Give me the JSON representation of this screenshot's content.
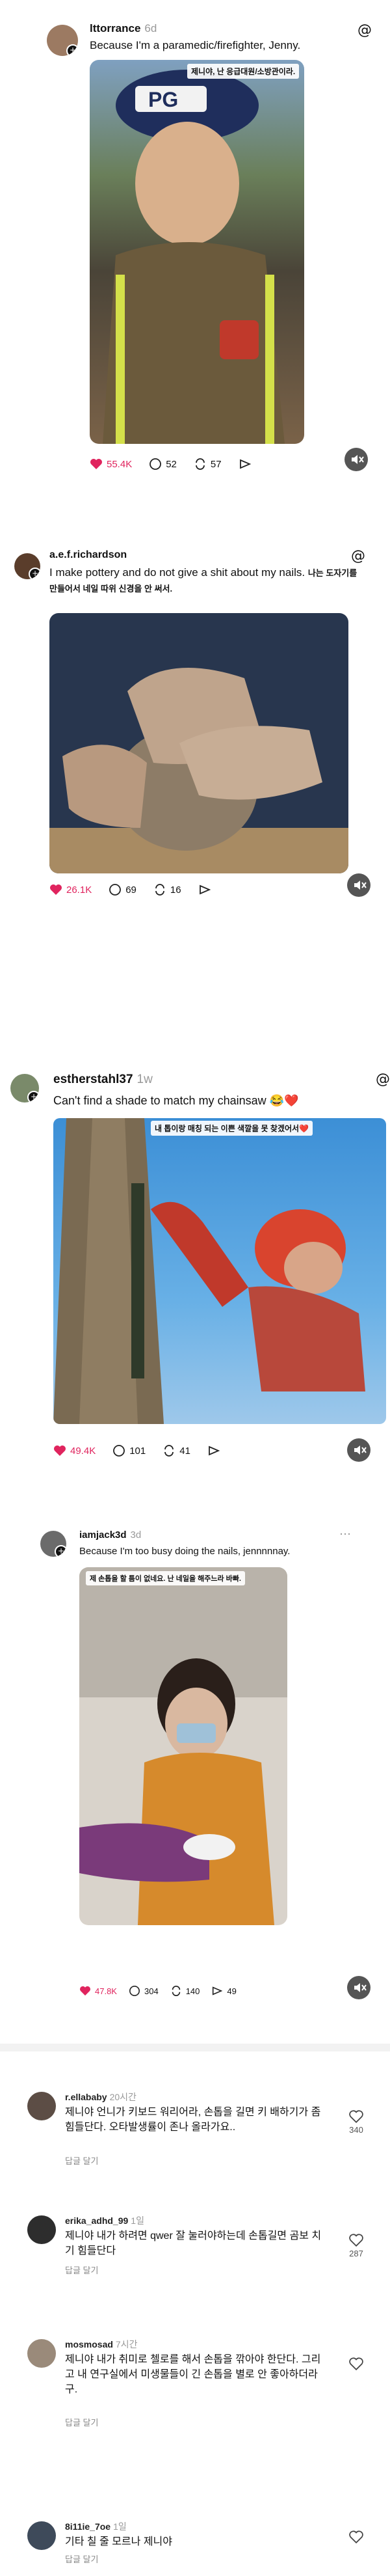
{
  "posts": [
    {
      "username": "lttorrance",
      "time": "6d",
      "caption": "Because I'm a paramedic/firefighter, Jenny.",
      "overlay": "제니야, 난 응급대원/소방관이라.",
      "likes": "55.4K",
      "comments": "52",
      "reposts": "57"
    },
    {
      "username": "a.e.f.richardson",
      "time": "",
      "caption": "I make pottery and do not give a shit about my nails.",
      "caption_ko": "나는 도자기를 만들어서 네일 따위 신경을 안 써서.",
      "likes": "26.1K",
      "comments": "69",
      "reposts": "16"
    },
    {
      "username": "estherstahl37",
      "time": "1w",
      "caption": "Can't find a shade to match my chainsaw 😂❤️",
      "overlay": "내 톱이랑 매칭 되는 이쁜 색깔을 못 찾겠어서❤️",
      "likes": "49.4K",
      "comments": "101",
      "reposts": "41"
    },
    {
      "username": "iamjack3d",
      "time": "3d",
      "caption": "Because I'm too busy doing the nails, jennnnnay.",
      "overlay": "제 손톱을 할 틈이 없네요. 난 네일을 해주느라 바빠.",
      "likes": "47.8K",
      "comments": "304",
      "reposts": "140",
      "shares": "49"
    }
  ],
  "comments": [
    {
      "username": "r.ellababy",
      "time": "20시간",
      "text": "제니야 언니가 키보드 워리어라, 손톱을 길면 키 배하기가 좀 힘들단다. 오타발생률이 존나 올라가요..",
      "reply": "답글 달기",
      "likes": "340"
    },
    {
      "username": "erika_adhd_99",
      "time": "1일",
      "text": "제니야 내가 하려면 qwer 잘 눌러야하는데 손톱길면 곰보 치기 힘들단다",
      "reply": "답글 달기",
      "likes": "287"
    },
    {
      "username": "mosmosad",
      "time": "7시간",
      "text": "제니야 내가 취미로 첼로를 해서 손톱을 깎아야 한단다. 그리고 내 연구실에서 미생물들이 긴 손톱을 별로 안 좋아하더라구.",
      "reply": "답글 달기",
      "likes": ""
    },
    {
      "username": "8i11ie_7oe",
      "time": "1일",
      "text": "기타 칠 줄 모르나 제니야",
      "reply": "답글 달기",
      "likes": ""
    }
  ],
  "colors": {
    "heart": "#e0245e",
    "muted_text": "#999999",
    "divider": "#f2f2f2"
  }
}
